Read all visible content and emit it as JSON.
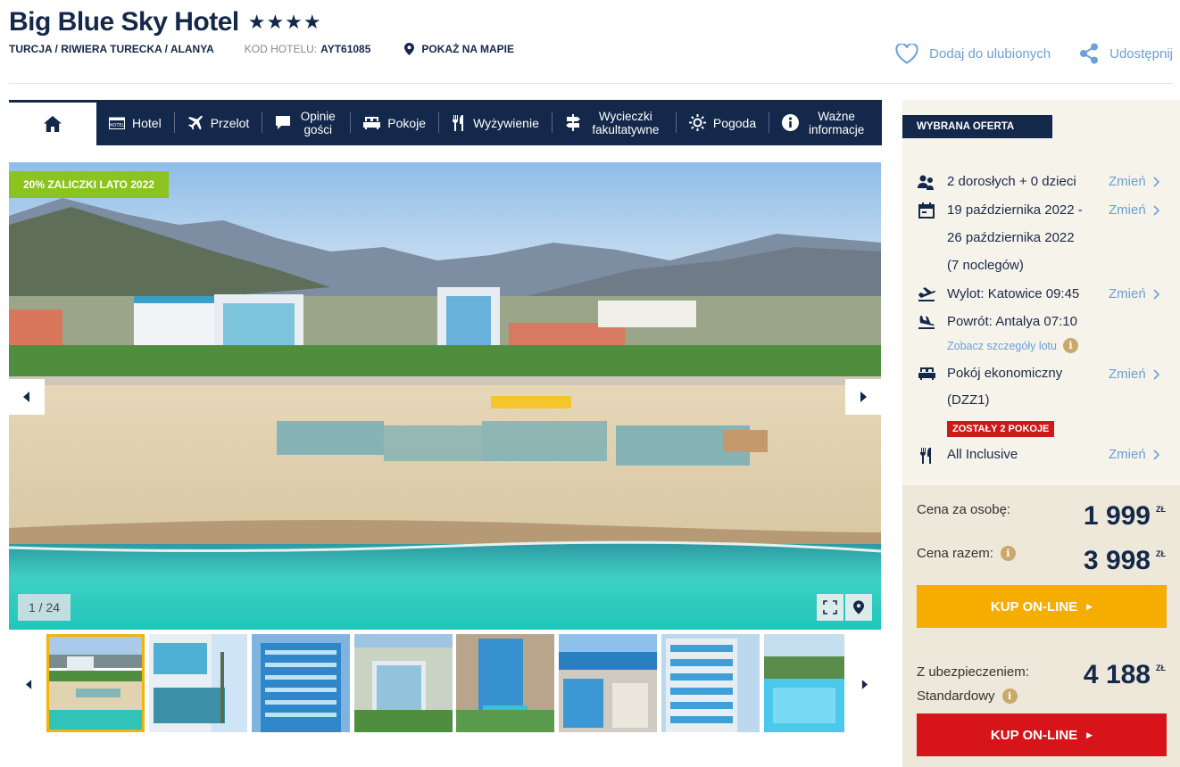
{
  "header": {
    "title": "Big Blue Sky Hotel",
    "stars": "★★★★",
    "location": "TURCJA / RIWIERA TURECKA / ALANYA",
    "code_label": "KOD HOTELU:",
    "code_value": "AYT61085",
    "map_label": "POKAŻ NA MAPIE",
    "favorite_label": "Dodaj do ulubionych",
    "share_label": "Udostępnij"
  },
  "nav": {
    "items": [
      {
        "label": "Hotel"
      },
      {
        "label": "Przelot"
      },
      {
        "label": "Opinie gości"
      },
      {
        "label": "Pokoje"
      },
      {
        "label": "Wyżywienie"
      },
      {
        "label": "Wycieczki fakultatywne"
      },
      {
        "label": "Pogoda"
      },
      {
        "label": "Ważne informacje"
      }
    ]
  },
  "gallery": {
    "promo_badge": "20% ZALICZKI LATO 2022",
    "counter": "1 / 24"
  },
  "offer": {
    "tab_label": "WYBRANA OFERTA",
    "guests": "2 dorosłych + 0 dzieci",
    "dates_line1": "19 października 2022 -",
    "dates_line2": "26 października 2022",
    "nights": "(7 noclegów)",
    "departure": "Wylot: Katowice 09:45",
    "return": "Powrót: Antalya 07:10",
    "flight_details": "Zobacz szczegóły lotu",
    "room_line1": "Pokój ekonomiczny",
    "room_line2": "(DZZ1)",
    "rooms_left": "ZOSTAŁY 2 POKOJE",
    "board": "All Inclusive",
    "change_label": "Zmień"
  },
  "pricing": {
    "per_person_label": "Cena za osobę:",
    "per_person_value": "1 999",
    "total_label": "Cena razem:",
    "total_value": "3 998",
    "currency": "ZŁ",
    "buy_label": "KUP ON-LINE",
    "insurance_label_1": "Z ubezpieczeniem:",
    "insurance_label_2": "Standardowy",
    "insurance_value": "4 188",
    "buy_insured_label": "KUP ON-LINE"
  },
  "colors": {
    "navy": "#14284b",
    "link": "#6ca0d6",
    "promo": "#8bc31f",
    "buy_yellow": "#f5ad00",
    "buy_red": "#d7141a"
  }
}
